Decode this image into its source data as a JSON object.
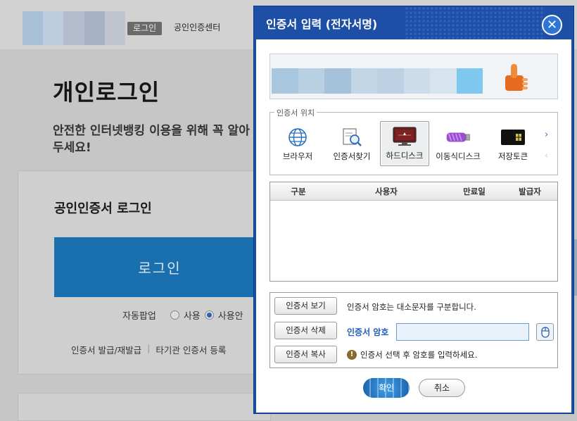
{
  "background": {
    "top_login_button": "로그인",
    "top_center_link": "공인인증센터",
    "page_title": "개인로그인",
    "page_subtitle": "안전한 인터넷뱅킹 이용을 위해 꼭 알아두세요!",
    "card_title": "공인인증서 로그인",
    "login_button": "로그인",
    "autopopup": {
      "label": "자동팝업",
      "options": [
        "사용",
        "사용안"
      ],
      "selected": "사용안"
    },
    "links": [
      "인증서 발급/재발급",
      "타기관 인증서 등록"
    ]
  },
  "dialog": {
    "title": "인증서 입력 (전자서명)",
    "close_icon": "close-icon",
    "location_legend": "인증서 위치",
    "locations": [
      {
        "label": "브라우저",
        "icon": "globe-icon",
        "selected": false
      },
      {
        "label": "인증서찾기",
        "icon": "certificate-search-icon",
        "selected": false
      },
      {
        "label": "하드디스크",
        "icon": "monitor-icon",
        "selected": true
      },
      {
        "label": "이동식디스크",
        "icon": "usb-drive-icon",
        "selected": false
      },
      {
        "label": "저장토큰",
        "icon": "token-icon",
        "selected": false
      }
    ],
    "table_headers": [
      "구분",
      "사용자",
      "만료일",
      "발급자"
    ],
    "buttons": {
      "view": "인증서 보기",
      "delete": "인증서 삭제",
      "copy": "인증서 복사"
    },
    "case_note": "인증서 암호는 대소문자를 구분합니다.",
    "password_label": "인증서 암호",
    "password_value": "",
    "warning": "인증서 선택 후 암호를 입력하세요.",
    "ok": "확인",
    "cancel": "취소",
    "colors": {
      "header": "#1d4fa6",
      "accent": "#1e5fb8"
    }
  }
}
